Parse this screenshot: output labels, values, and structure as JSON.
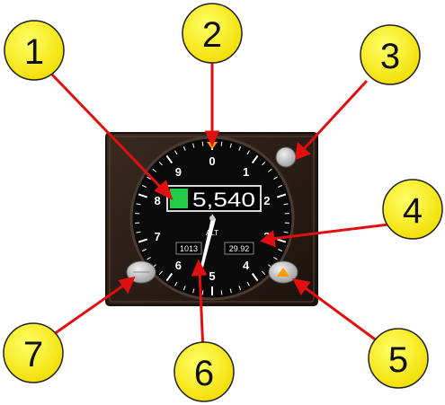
{
  "instrument": {
    "altitude_readout": "5,540",
    "altitude_readout_display": "5540",
    "alt_label": "ALT",
    "baro_hpa": "1013",
    "baro_inhg": "29.92",
    "dial_numbers": [
      "0",
      "1",
      "2",
      "3",
      "4",
      "5",
      "6",
      "7",
      "8",
      "9"
    ]
  },
  "callouts": [
    {
      "number": "1"
    },
    {
      "number": "2"
    },
    {
      "number": "3"
    },
    {
      "number": "4"
    },
    {
      "number": "5"
    },
    {
      "number": "6"
    },
    {
      "number": "7"
    }
  ],
  "colors": {
    "callout_fill": "#fff200",
    "arrow": "#e01010",
    "bezel": "#2b1e17",
    "dial": "#080808",
    "indicator_green": "#22cc44",
    "orange_flag": "#ff9a00"
  }
}
